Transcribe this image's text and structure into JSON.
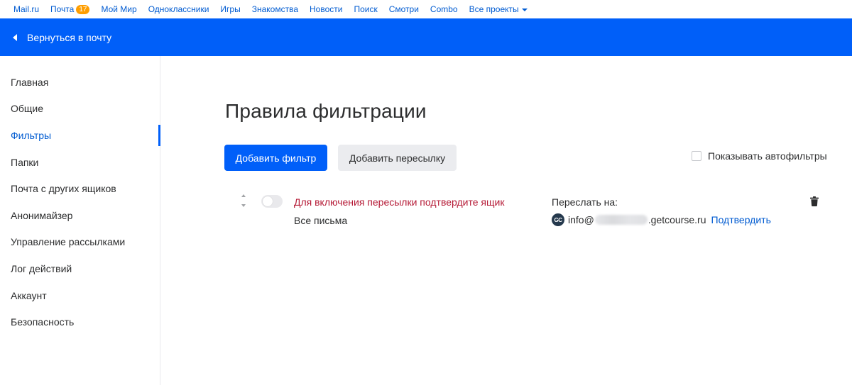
{
  "portal": {
    "links": [
      "Mail.ru",
      "Почта",
      "Мой Мир",
      "Одноклассники",
      "Игры",
      "Знакомства",
      "Новости",
      "Поиск",
      "Смотри",
      "Combo",
      "Все проекты"
    ],
    "mail_badge": "17"
  },
  "header": {
    "back_label": "Вернуться в почту"
  },
  "sidebar": {
    "items": [
      {
        "label": "Главная"
      },
      {
        "label": "Общие"
      },
      {
        "label": "Фильтры",
        "active": true
      },
      {
        "label": "Папки"
      },
      {
        "label": "Почта с других ящиков"
      },
      {
        "label": "Анонимайзер"
      },
      {
        "label": "Управление рассылками"
      },
      {
        "label": "Лог действий"
      },
      {
        "label": "Аккаунт"
      },
      {
        "label": "Безопасность"
      }
    ]
  },
  "main": {
    "title": "Правила фильтрации",
    "add_filter_label": "Добавить фильтр",
    "add_forward_label": "Добавить пересылку",
    "show_autofilters_label": "Показывать автофильтры",
    "filter": {
      "warning": "Для включения пересылки подтвердите ящик",
      "condition": "Все письма",
      "forward_label": "Переслать на:",
      "avatar_text": "GC",
      "email_prefix": "info@",
      "email_suffix": ".getcourse.ru",
      "confirm_label": "Подтвердить"
    }
  },
  "colors": {
    "brand_blue": "#005ff9",
    "link_blue": "#005bd1",
    "warning_red": "#b51a36",
    "badge_orange": "#ff9e00"
  }
}
